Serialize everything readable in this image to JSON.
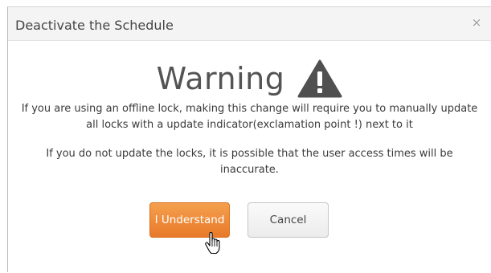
{
  "dialog": {
    "title": "Deactivate the Schedule",
    "close_glyph": "×",
    "close_icon": "close-icon"
  },
  "warning": {
    "heading": "Warning",
    "icon": "warning-triangle-icon",
    "message_1": "If you are using an offline lock, making this change will require you to manually update all locks with a update indicator(exclamation point !) next to it",
    "message_2": "If you do not update the locks, it is possible that the user access times will be inaccurate."
  },
  "buttons": {
    "understand_label": "I Understand",
    "cancel_label": "Cancel"
  },
  "cursor": {
    "icon": "hand-pointer-cursor-icon"
  },
  "colors": {
    "primary_button": "#e8792a",
    "header_background": "#f4f4f4",
    "warning_icon": "#505050"
  }
}
